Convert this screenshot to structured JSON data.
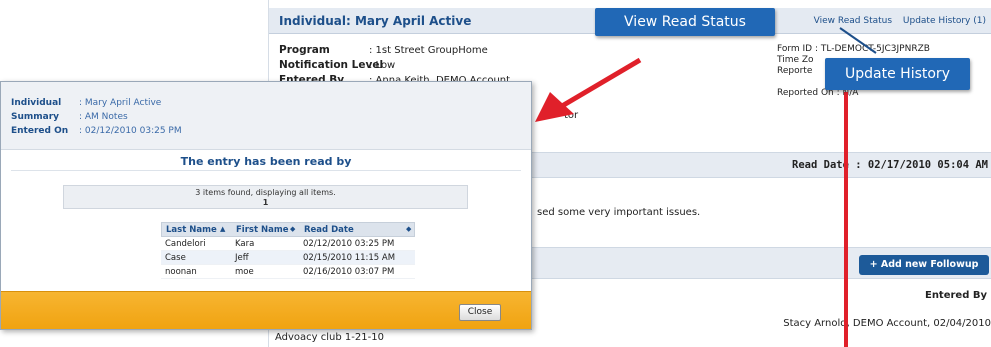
{
  "background": {
    "title": "Individual: Mary April Active",
    "links": {
      "read_status": "View Read Status",
      "update_history": "Update History (1)"
    },
    "fields": [
      {
        "label": "Program",
        "value": ": 1st Street GroupHome"
      },
      {
        "label": "Notification Level",
        "value": ": Low"
      },
      {
        "label": "Entered By",
        "value": ": Anna Keith, DEMO Account"
      }
    ],
    "right_fields": {
      "form_id": "Form ID      : TL-DEMOCT-5JC3JPNRZB",
      "time_zone": "Time Zo",
      "reported_by": "Reporte",
      "reported_on": "Reported On : N/A"
    },
    "partial_text": "tor",
    "read_date": "Read Date : 02/17/2010 05:04 AM",
    "note_text": "sed some very important issues.",
    "add_followup": "+ Add new Followup",
    "entered_by_header": "Entered By",
    "followup_entry": "Stacy Arnold, DEMO Account, 02/04/2010",
    "followup_title": "Advoacy club 1-21-10"
  },
  "callouts": {
    "read_status": "View Read Status",
    "update_history": "Update History"
  },
  "modal": {
    "individual_label": "Individual",
    "individual_value": ": Mary April Active",
    "summary_label": "Summary",
    "summary_value": ": AM Notes",
    "entered_on_label": "Entered On",
    "entered_on_value": ": 02/12/2010 03:25 PM",
    "heading": "The entry has been read by",
    "pager_text": "3 items found, displaying all items.",
    "pager_page": "1",
    "columns": [
      "Last Name",
      "First Name",
      "Read Date"
    ],
    "rows": [
      {
        "last": "Candelori",
        "first": "Kara",
        "date": "02/12/2010 03:25 PM"
      },
      {
        "last": "Case",
        "first": "Jeff",
        "date": "02/15/2010 11:15 AM"
      },
      {
        "last": "noonan",
        "first": "moe",
        "date": "02/16/2010 03:07 PM"
      }
    ],
    "close_label": "Close"
  },
  "colors": {
    "accent": "#1d4f8a",
    "callout": "#2168b6",
    "footer": "#f0a20f",
    "arrow": "#e0202a"
  },
  "icons": {
    "sort_asc": "sort-asc-icon",
    "sort_both": "sort-both-icon"
  }
}
